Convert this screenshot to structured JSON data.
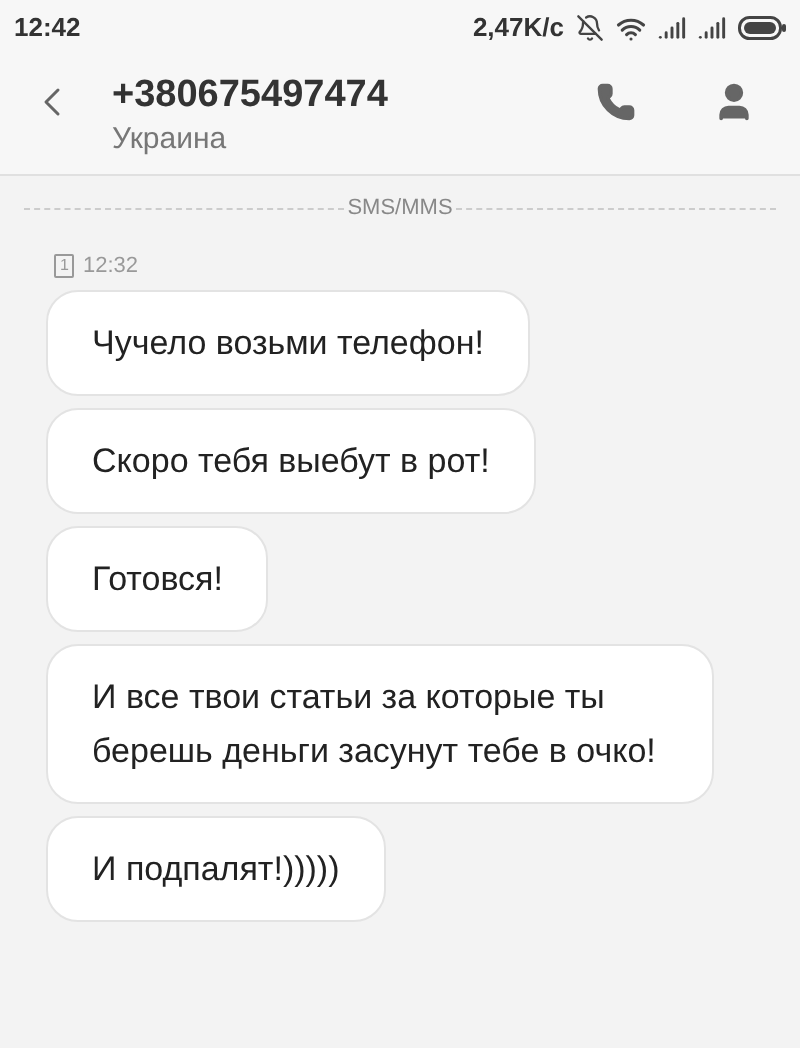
{
  "status_bar": {
    "time": "12:42",
    "speed": "2,47K/с"
  },
  "header": {
    "title": "+380675497474",
    "subtitle": "Украина"
  },
  "divider_label": "SMS/MMS",
  "timestamp": {
    "sim": "1",
    "time": "12:32"
  },
  "messages": [
    {
      "text": "Чучело возьми телефон!"
    },
    {
      "text": "Скоро тебя выебут в рот!"
    },
    {
      "text": "Готовся!"
    },
    {
      "text": "И все твои статьи за которые ты берешь деньги засунут тебе в очко!"
    },
    {
      "text": "И подпалят!)))))"
    }
  ]
}
